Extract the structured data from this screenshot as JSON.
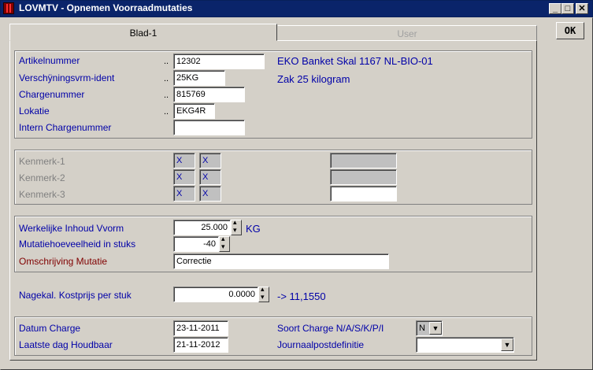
{
  "window": {
    "title": "LOVMTV - Opnemen Voorraadmutaties",
    "min": "_",
    "max": "□",
    "close": "✕"
  },
  "ok_label": "OK",
  "tabs": [
    {
      "label": "Blad-1"
    },
    {
      "label": "User"
    }
  ],
  "article": {
    "artikelnummer_label": "Artikelnummer",
    "artikelnummer_value": "12302",
    "artikel_desc": "EKO Banket Skal 1167 NL-BIO-01",
    "vorm_label": "Verschÿningsvrm-ident",
    "vorm_value": "25KG",
    "vorm_desc": "Zak 25 kilogram",
    "charge_label": "Chargenummer",
    "charge_value": "815769",
    "lokatie_label": "Lokatie",
    "lokatie_value": "EKG4R",
    "intern_label": "Intern Chargenummer",
    "intern_value": "",
    "dots": ".."
  },
  "kenmerken": [
    {
      "label": "Kenmerk-1",
      "a": "X",
      "b": "X",
      "c": ""
    },
    {
      "label": "Kenmerk-2",
      "a": "X",
      "b": "X",
      "c": ""
    },
    {
      "label": "Kenmerk-3",
      "a": "X",
      "b": "X",
      "c": ""
    }
  ],
  "mutation": {
    "inhoud_label": "Werkelijke Inhoud Vvorm",
    "inhoud_value": "25.000",
    "inhoud_unit": "KG",
    "hoeveelheid_label": "Mutatiehoeveelheid in stuks",
    "hoeveelheid_value": "-40",
    "omschrijving_label": "Omschrijving Mutatie",
    "omschrijving_value": "Correctie"
  },
  "kostprijs": {
    "label": "Nagekal. Kostprijs per stuk",
    "value": "0.0000",
    "result": "-> 11,1550"
  },
  "dates": {
    "datum_label": "Datum Charge",
    "datum_value": "23-11-2011",
    "houdbaar_label": "Laatste dag Houdbaar",
    "houdbaar_value": "21-11-2012",
    "soort_label": "Soort Charge N/A/S/K/P/I",
    "soort_value": "N",
    "journaal_label": "Journaalpostdefinitie",
    "journaal_value": ""
  }
}
